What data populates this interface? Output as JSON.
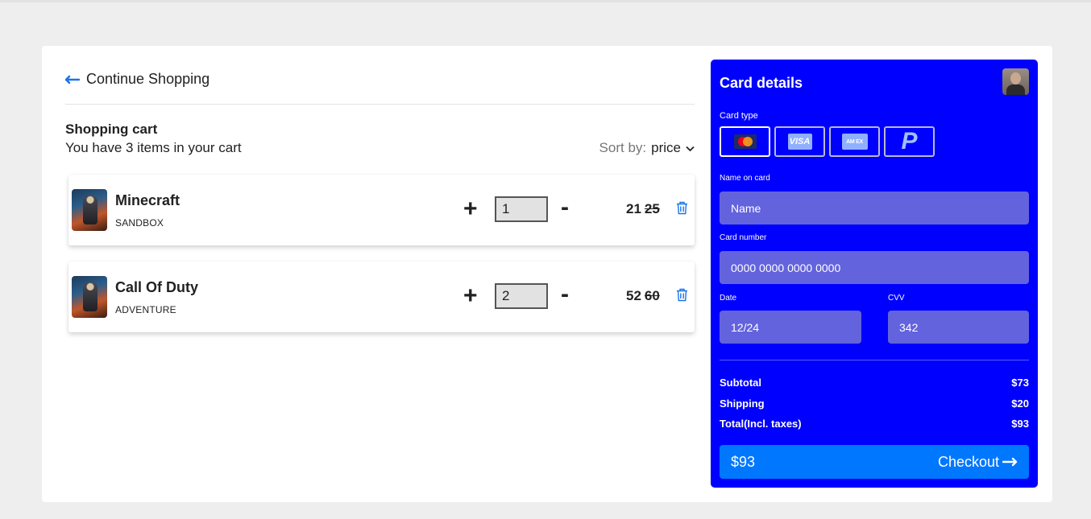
{
  "nav": {
    "continue_label": "Continue Shopping"
  },
  "cart": {
    "title": "Shopping cart",
    "subtitle": "You have 3 items in your cart",
    "sort_label": "Sort by:",
    "sort_value": "price",
    "items": [
      {
        "name": "Minecraft",
        "category": "SANDBOX",
        "qty": "1",
        "price": "21",
        "old_price": "25"
      },
      {
        "name": "Call Of Duty",
        "category": "ADVENTURE",
        "qty": "2",
        "price": "52",
        "old_price": "60"
      }
    ],
    "plus": "+",
    "minus": "-"
  },
  "card": {
    "title": "Card details",
    "card_type_label": "Card type",
    "card_types": [
      "mastercard-icon",
      "visa-icon",
      "amex-icon",
      "paypal-icon"
    ],
    "visa_text": "VISA",
    "amex_text": "AM EX",
    "name_label": "Name on card",
    "name_placeholder": "Name",
    "number_label": "Card number",
    "number_placeholder": "0000 0000 0000 0000",
    "date_label": "Date",
    "date_value": "12/24",
    "cvv_label": "CVV",
    "cvv_value": "342",
    "subtotal_label": "Subtotal",
    "subtotal_value": "$73",
    "shipping_label": "Shipping",
    "shipping_value": "$20",
    "total_label": "Total(Incl. taxes)",
    "total_value": "$93",
    "checkout_amount": "$93",
    "checkout_label": "Checkout"
  },
  "colors": {
    "panel": "#0000ff",
    "field": "#6363dd",
    "checkout": "#0077ff",
    "accent": "#1a73e8"
  }
}
